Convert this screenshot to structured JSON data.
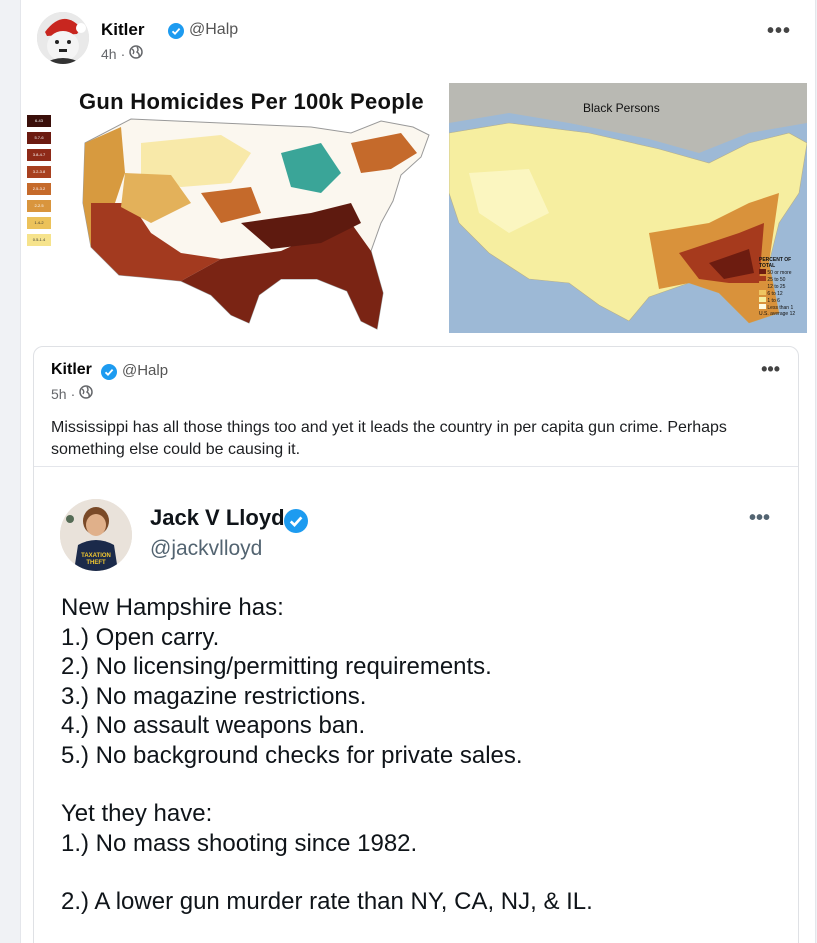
{
  "post": {
    "author": "Kitler",
    "handle": "@Halp",
    "time": "4h",
    "more": "•••"
  },
  "images": {
    "left": {
      "title": "Gun Homicides Per 100k People",
      "legend": [
        "6-43",
        "5.7-6",
        "3.8-4.7",
        "3.2-3.8",
        "2.5-3.2",
        "2-2.5",
        "1.4-2",
        "0.5-1.4"
      ],
      "colors": [
        "#3a0f0a",
        "#6b1a10",
        "#8e2a18",
        "#a8401f",
        "#c56a2b",
        "#d9953d",
        "#ecc25a",
        "#f6e38c"
      ]
    },
    "right": {
      "label": "Black Persons",
      "legend_title": "PERCENT OF TOTAL",
      "legend": [
        "50 or more",
        "25 to 50",
        "12 to 25",
        "6 to 12",
        "1 to 6",
        "Less than 1"
      ],
      "legend_note": "U.S. average 12"
    }
  },
  "quoted": {
    "author": "Kitler",
    "handle": "@Halp",
    "time": "5h",
    "more": "•••",
    "text": "Mississippi has all those things too and yet it leads the country in per capita gun crime. Perhaps something else could be causing it."
  },
  "embed": {
    "name": "Jack V Lloyd",
    "handle": "@jackvlloyd",
    "more": "•••",
    "lines_a": [
      "New Hampshire has:",
      "1.) Open carry.",
      "2.) No licensing/permitting requirements.",
      "3.) No magazine restrictions.",
      "4.) No assault weapons ban.",
      "5.) No background checks for private sales."
    ],
    "lines_b": [
      "Yet they have:",
      "1.) No mass shooting since 1982."
    ],
    "lines_c": [
      "2.) A lower gun murder rate than NY, CA, NJ, & IL."
    ]
  },
  "colors": {
    "verified": "#1d9bf0",
    "accent_text": "#050505"
  }
}
